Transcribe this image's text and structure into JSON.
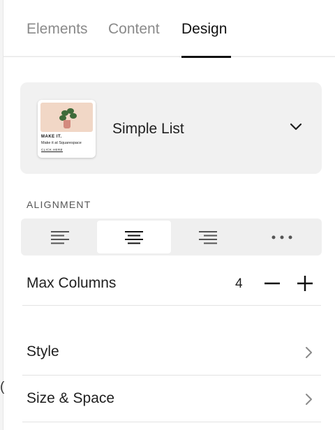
{
  "tabs": [
    {
      "label": "Elements",
      "active": false
    },
    {
      "label": "Content",
      "active": false
    },
    {
      "label": "Design",
      "active": true
    }
  ],
  "layout": {
    "name": "Simple List",
    "thumbnail": {
      "title": "MAKE IT.",
      "subtitle": "Make it at Squarespace",
      "link": "CLICK HERE"
    },
    "dropdown_icon": "chevron-down-icon"
  },
  "alignment": {
    "label": "ALIGNMENT",
    "options": [
      {
        "name": "align-left-icon",
        "selected": false
      },
      {
        "name": "align-center-icon",
        "selected": true
      },
      {
        "name": "align-right-icon",
        "selected": false
      },
      {
        "name": "more-options-icon",
        "selected": false
      }
    ]
  },
  "max_columns": {
    "label": "Max Columns",
    "value": "4",
    "decrement_icon": "minus-icon",
    "increment_icon": "plus-icon"
  },
  "nav_rows": [
    {
      "label": "Style",
      "icon": "chevron-right-icon"
    },
    {
      "label": "Size & Space",
      "icon": "chevron-right-icon"
    }
  ],
  "left_edge_glyph": "(",
  "colors": {
    "active_tab": "#111111",
    "inactive_tab": "#8a8a8a",
    "card_background": "#f1f1f1",
    "selected_segment": "#ffffff"
  }
}
